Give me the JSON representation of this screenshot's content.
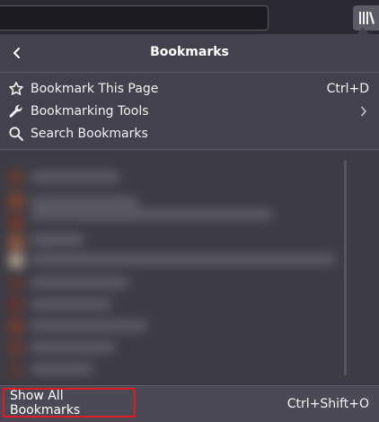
{
  "panel": {
    "title": "Bookmarks",
    "items": [
      {
        "label": "Bookmark This Page",
        "shortcut": "Ctrl+D",
        "icon": "star-icon"
      },
      {
        "label": "Bookmarking Tools",
        "shortcut": "",
        "icon": "wrench-icon",
        "has_submenu": true
      },
      {
        "label": "Search Bookmarks",
        "shortcut": "",
        "icon": "search-icon"
      }
    ],
    "footer": {
      "label": "Show All Bookmarks",
      "shortcut": "Ctrl+Shift+O"
    }
  },
  "colors": {
    "panel_bg": "#42414d",
    "toolbar_bg": "#2b2a33",
    "highlight_border": "#e01b24"
  }
}
